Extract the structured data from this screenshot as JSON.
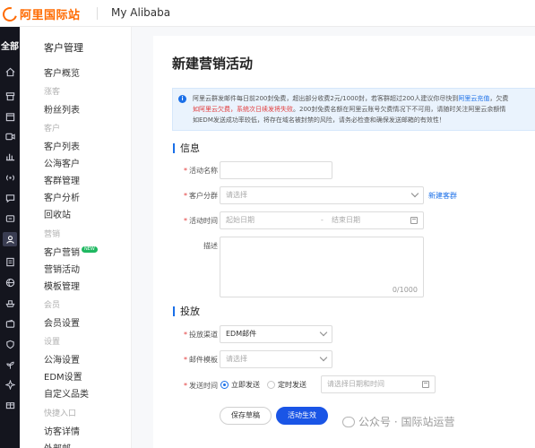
{
  "topbar": {
    "logo_text": "阿里国际站",
    "title": "My Alibaba"
  },
  "rail": {
    "all_label": "全部",
    "icons": [
      "home-icon",
      "store-icon",
      "calendar-icon",
      "video-icon",
      "chart-icon",
      "broadcast-icon",
      "message-icon",
      "users-icon",
      "document-icon",
      "globe-icon",
      "ship-icon",
      "wallet-icon",
      "shield-icon",
      "sprout-icon",
      "star-icon",
      "gift-icon"
    ]
  },
  "menu": {
    "title": "客户管理",
    "overview": "客户概览",
    "group_fans": "涨客",
    "fans_list": "粉丝列表",
    "group_customer": "客户",
    "customer_list": "客户列表",
    "public_customer": "公海客户",
    "customer_group": "客群管理",
    "customer_analysis": "客户分析",
    "recycle_bin": "回收站",
    "group_marketing": "营销",
    "customer_marketing": "客户营销",
    "new_badge": "NEW",
    "marketing_activity": "营销活动",
    "template_manage": "模板管理",
    "group_member": "会员",
    "member_settings": "会员设置",
    "group_settings": "设置",
    "public_settings": "公海设置",
    "edm_settings": "EDM设置",
    "custom_category": "自定义品类",
    "group_quick": "快捷入口",
    "visitor_detail": "访客详情",
    "more": "外部邮"
  },
  "page": {
    "title": "新建营销活动",
    "notice": {
      "line1_a": "阿里云群发邮件每日前200封免费，超出部分收费2元/1000封，若客群超过200人建议你尽快到",
      "line1_link": "阿里云充值",
      "line1_b": "，欠费",
      "line2_red": "如阿里云欠费，系统次日续发将失败",
      "line2_b": "。200封免费名额在阿里云账号欠费情况下不可用，请随时关注阿里云余额情",
      "line3": "如EDM发送成功率较低，将存在域名被封禁的风险，请务必检查和确保发送邮箱的有效性！"
    },
    "info_section": "信息",
    "activity_name_label": "活动名称",
    "activity_name_value": "",
    "customer_group_label": "客户分群",
    "customer_group_placeholder": "请选择",
    "new_group_link": "新建客群",
    "activity_time_label": "活动时间",
    "start_date_placeholder": "起始日期",
    "date_separator": "-",
    "end_date_placeholder": "结束日期",
    "desc_label": "描述",
    "desc_counter": "0/1000",
    "delivery_section": "投放",
    "channel_label": "投放渠道",
    "channel_value": "EDM邮件",
    "template_label": "邮件模板",
    "template_placeholder": "请选择",
    "send_time_label": "发送时间",
    "send_now_label": "立即发送",
    "send_scheduled_label": "定时发送",
    "datetime_placeholder": "请选择日期和时间",
    "save_draft_label": "保存草稿",
    "activate_label": "活动生效"
  },
  "watermark": "公众号 · 国际站运营"
}
